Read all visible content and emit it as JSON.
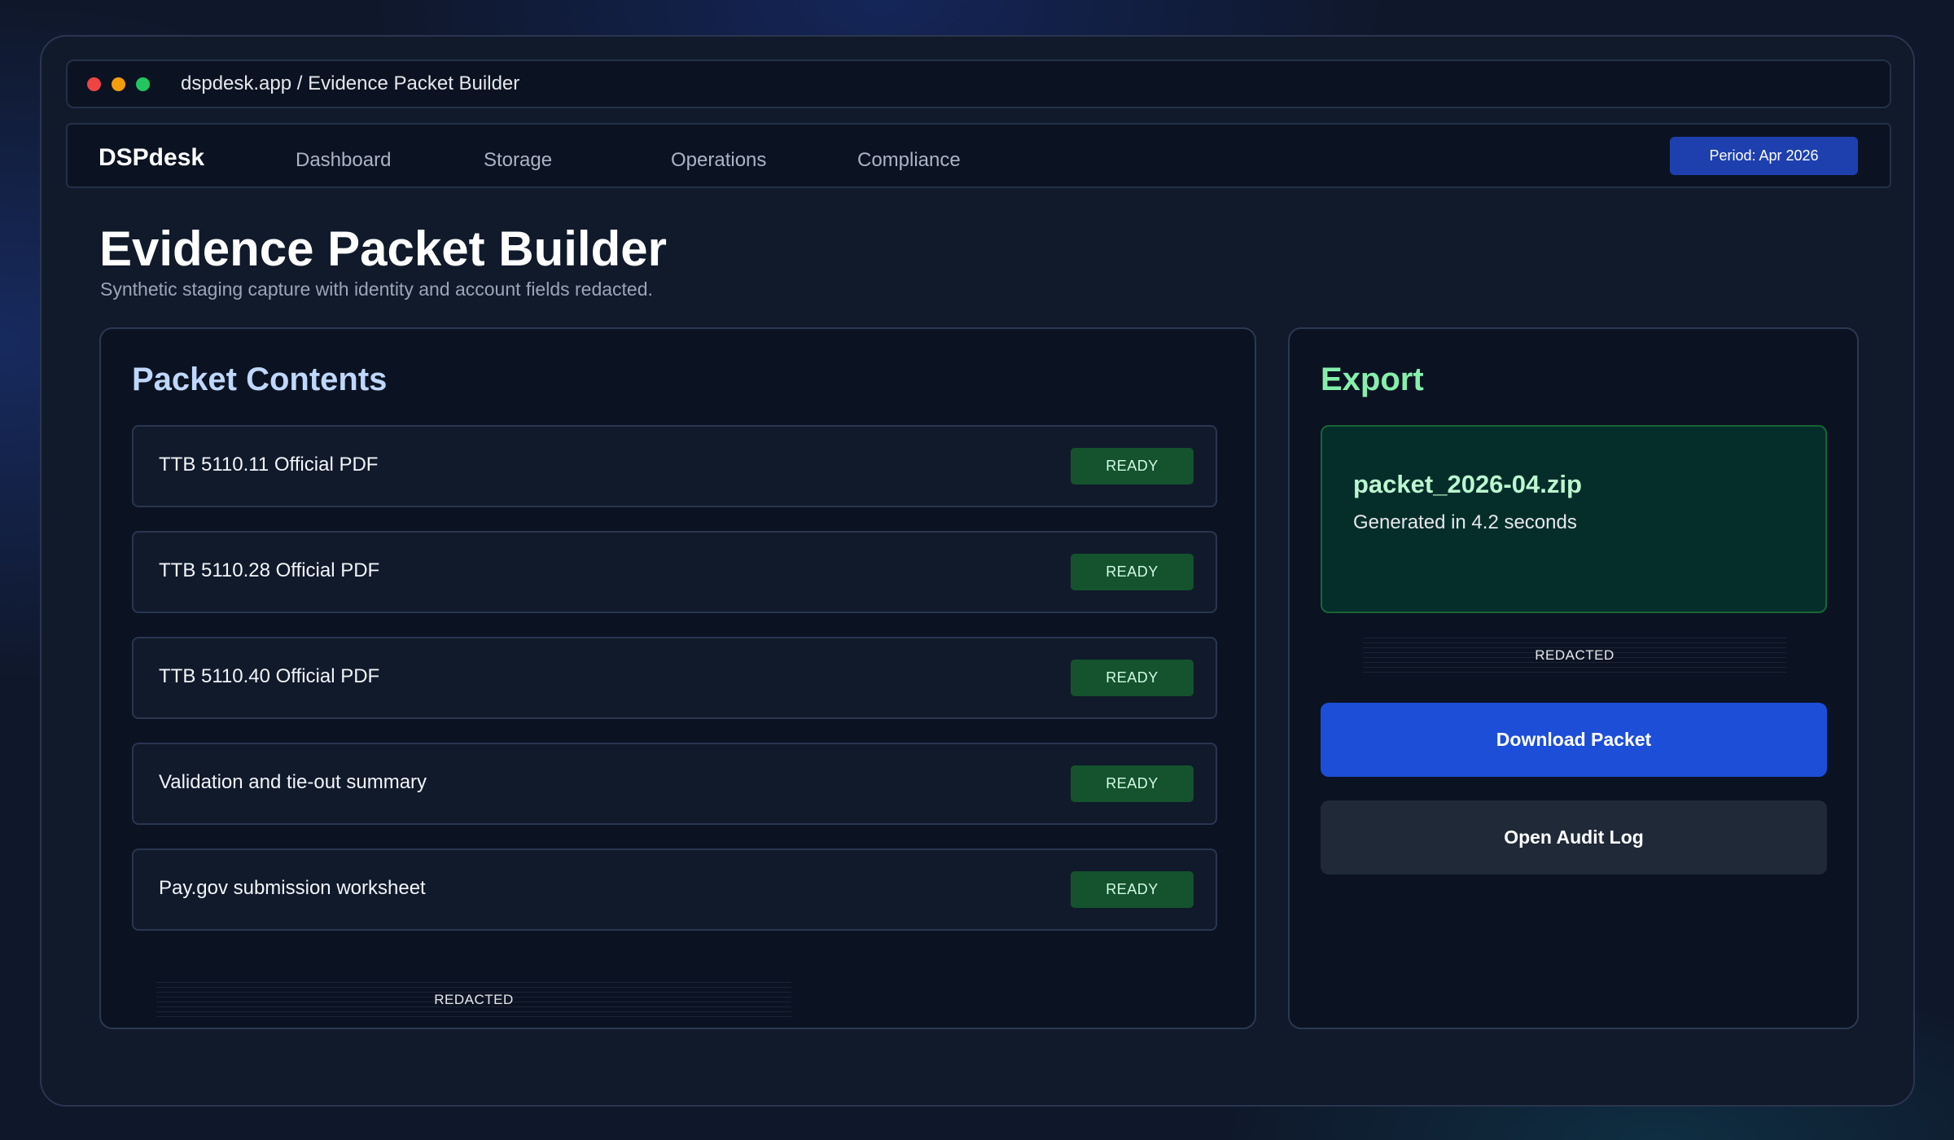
{
  "window": {
    "url": "dspdesk.app / Evidence Packet Builder"
  },
  "nav": {
    "brand": "DSPdesk",
    "items": [
      "Dashboard",
      "Storage",
      "Operations",
      "Compliance"
    ],
    "period": "Period: Apr 2026"
  },
  "page": {
    "title": "Evidence Packet Builder",
    "subtitle": "Synthetic staging capture with identity and account fields redacted."
  },
  "packet": {
    "heading": "Packet Contents",
    "items": [
      {
        "label": "TTB 5110.11 Official PDF",
        "status": "READY"
      },
      {
        "label": "TTB 5110.28 Official PDF",
        "status": "READY"
      },
      {
        "label": "TTB 5110.40 Official PDF",
        "status": "READY"
      },
      {
        "label": "Validation and tie-out summary",
        "status": "READY"
      },
      {
        "label": "Pay.gov submission worksheet",
        "status": "READY"
      }
    ],
    "redacted_label": "REDACTED"
  },
  "export": {
    "heading": "Export",
    "filename": "packet_2026-04.zip",
    "meta": "Generated in 4.2 seconds",
    "redacted_label": "REDACTED",
    "download_label": "Download Packet",
    "audit_label": "Open Audit Log"
  },
  "colors": {
    "accent": "#1d4ed8",
    "ready": "#14532d",
    "export_heading": "#86efac"
  }
}
